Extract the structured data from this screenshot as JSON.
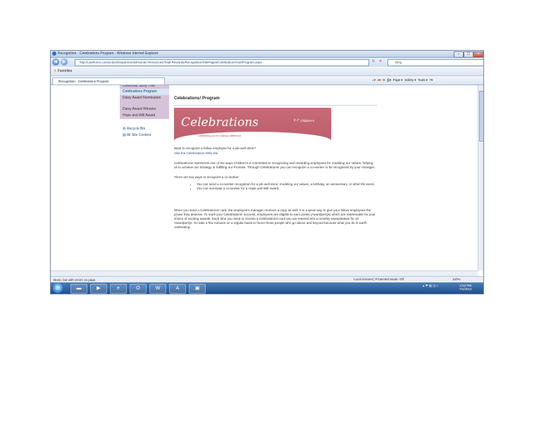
{
  "window": {
    "title": "Recognition - Celebrations Program - Windows Internet Explorer",
    "minimize_glyph": "–",
    "maximize_glyph": "□",
    "close_glyph": "×"
  },
  "address_bar": {
    "url": "http://careforce.connection/Departments/Human Resources/Total Rewards/Recognition/SitePages/Celebrations%20Program.aspx",
    "search_placeholder": "Bing"
  },
  "favorites_bar": {
    "favorites_label": "Favorites"
  },
  "tab": {
    "label": "Recognition - Celebrations Program"
  },
  "command_bar": {
    "page_label": "Page ▾",
    "safety_label": "Safety ▾",
    "tools_label": "Tools ▾"
  },
  "left_nav": {
    "items": [
      {
        "label": "Celebrations Program",
        "selected": true
      },
      {
        "label": "Daisy Award Nomination"
      },
      {
        "label": "Daisy Award Winners"
      },
      {
        "label": "Hope and Will Award"
      }
    ],
    "truncated_top": "Celebrate Story Tree",
    "recycle_bin": "Recycle Bin",
    "all_site_content": "All Site Content"
  },
  "main": {
    "page_title": "Celebrations! Program",
    "banner": {
      "word": "Celebrations",
      "tagline": "Celebrating you for making a difference",
      "logo_text": "Children's"
    },
    "intro_question": "Want to recognize a fellow employee for a job well done?",
    "intro_link": "Visit the Celebrations Web site",
    "para1": "Celebrations! represents one of the ways Children's is committed to recognizing and rewarding employees for modeling our values, helping us to achieve our Strategy or fulfilling our Promise. Through Celebrations! you can recognize a co-worker or be recognized by your manager.",
    "ways_intro": "There are two ways to recognize a co-worker:",
    "bullets": [
      "You can send a co-worker recognition for a job well done, modeling our values, a birthday, an anniversary, or other life event.",
      "You can nominate a co-worker for a Hope and Will Award."
    ],
    "para2": "When you send a Celebrations! card, the employee's manager receives a copy as well. It is a great way to give your fellow employees the praise they deserve. To mark your Celebrations! success, employees are eligible to earn points (AwardperQs) which are redeemable for your choice of exciting awards. Each time you send or receive a Celebrations! card you are entered into a monthly sweepstakes for 10 AwardperQs. So take a few minutes on a regular basis to honor those people who go above and beyond because what you do is worth celebrating."
  },
  "status_bar": {
    "left": "Done, but with errors on page.",
    "zone": "Local intranet | Protected Mode: Off",
    "zoom": "100%"
  },
  "taskbar": {
    "clock_time": "2:53 PM",
    "clock_date": "7/1/2012"
  },
  "colors": {
    "accent": "#2d4f8a",
    "banner": "#c86a78",
    "nav_selected": "#d8e6f6",
    "taskbar": "#1f4f8a"
  }
}
